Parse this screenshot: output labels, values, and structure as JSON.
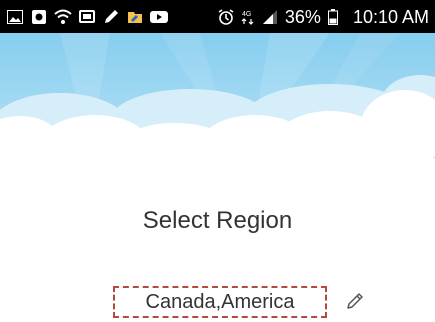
{
  "status_bar": {
    "left_icons": [
      "image-icon",
      "camera-icon",
      "wifi-icon",
      "cast-icon",
      "pencil-icon",
      "folder-icon",
      "youtube-icon"
    ],
    "right_icons": [
      "alarm-icon",
      "lte-4g-icon",
      "signal-icon",
      "battery-icon"
    ],
    "battery": "36%",
    "time": "10:10 AM"
  },
  "header": {
    "background": "sky-with-clouds",
    "colors": {
      "sky": "#aee0f7",
      "clouds": "#ffffff"
    }
  },
  "main": {
    "title": "Select Region",
    "region_value": "Canada,America",
    "edit_icon": "pencil-icon",
    "accent_color": "#b44a3e"
  }
}
